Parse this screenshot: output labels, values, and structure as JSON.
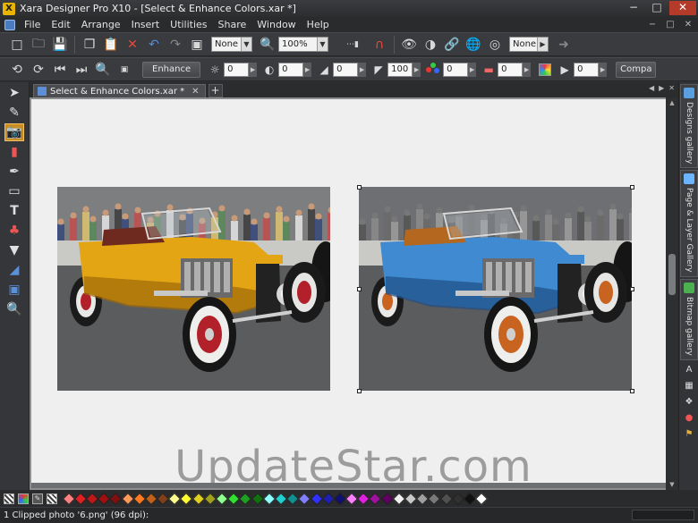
{
  "window": {
    "title": "Xara Designer Pro X10 - [Select & Enhance Colors.xar *]",
    "logo_letter": "X",
    "controls": [
      "−",
      "□",
      "✕"
    ]
  },
  "menu": {
    "items": [
      "File",
      "Edit",
      "Arrange",
      "Insert",
      "Utilities",
      "Share",
      "Window",
      "Help"
    ],
    "right_controls": [
      "−",
      "□",
      "✕"
    ]
  },
  "toolbar1": {
    "quality_dropdown": "None",
    "zoom_dropdown": "100%",
    "line_dropdown": "None"
  },
  "toolbar2": {
    "enhance_label": "Enhance",
    "brightness": "0",
    "contrast": "0",
    "saturation": "0",
    "sharpen": "100",
    "hue": "0",
    "temperature": "0",
    "blur": "0",
    "compare_label": "Compa"
  },
  "tabs": {
    "document_tab": "Select & Enhance Colors.xar *",
    "close_glyph": "✕",
    "new_tab_glyph": "+",
    "nav": [
      "◀",
      "▶",
      "✕"
    ]
  },
  "canvas": {
    "watermark": "UpdateStar.com",
    "photos": [
      {
        "id": "original",
        "car_body": "#e3a514",
        "car_shadow": "#9c6a08",
        "wheel_rim": "#b2202a",
        "seat": "#6e2a1e"
      },
      {
        "id": "enhanced",
        "car_body": "#3f8ad0",
        "car_shadow": "#1f4f86",
        "wheel_rim": "#c86420",
        "seat": "#b3671f"
      }
    ]
  },
  "galleries": {
    "tabs": [
      "Designs gallery",
      "Page & Layer Gallery",
      "Bitmap gallery"
    ],
    "tab_colors": [
      "#5aa0e0",
      "#6cb4ff",
      "#4caf50"
    ]
  },
  "palette": {
    "colors": [
      "#ff8080",
      "#e02020",
      "#c01818",
      "#a01010",
      "#801010",
      "#ff9a5a",
      "#ff7a20",
      "#c0601a",
      "#80401a",
      "#ffff90",
      "#ffff30",
      "#e0d020",
      "#a0a020",
      "#90ff90",
      "#30e030",
      "#20a020",
      "#107010",
      "#90ffff",
      "#20d0d0",
      "#109090",
      "#8080ff",
      "#3030ff",
      "#2020b0",
      "#101070",
      "#ff80ff",
      "#e020e0",
      "#a010a0",
      "#600060",
      "#f0f0f0",
      "#c8c8c8",
      "#a0a0a0",
      "#787878",
      "#505050",
      "#303030",
      "#101010",
      "#ffffff"
    ]
  },
  "status": {
    "text": "1 Clipped photo '6.png' (96 dpi):"
  }
}
